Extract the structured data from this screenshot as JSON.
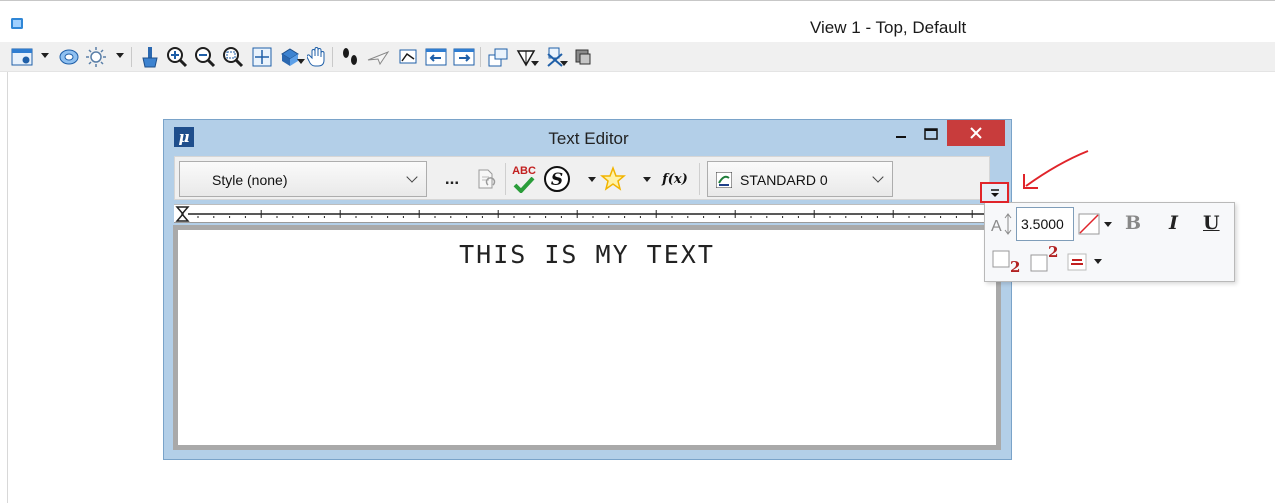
{
  "view": {
    "title": "View 1 - Top, Default",
    "toolbar_icons": [
      "view-attributes-icon",
      "display-style-icon",
      "brightness-icon",
      "update-view-icon",
      "zoom-in-icon",
      "zoom-out-icon",
      "window-area-icon",
      "fit-view-icon",
      "rotate-view-icon",
      "pan-view-icon",
      "walk-icon",
      "fly-icon",
      "change-view-perspective-icon",
      "previous-view-icon",
      "next-view-icon",
      "view-rotation-icon",
      "clip-volume-icon",
      "clip-mask-icon",
      "view-display-icon"
    ]
  },
  "text_editor": {
    "title": "Text Editor",
    "style_combo": "Style (none)",
    "ellipsis_label": "...",
    "spellcheck_label": "ABC",
    "fx_label": "f(x)",
    "font_combo": "STANDARD 0",
    "content_text": "THIS IS MY TEXT"
  },
  "format_panel": {
    "text_height": "3.5000",
    "bold_label": "B",
    "italic_label": "I",
    "underline_label": "U",
    "subscript_digit": "2",
    "superscript_digit": "2"
  },
  "colors": {
    "dialog_frame": "#b3cfe8",
    "close_button": "#c83c3c",
    "annotation": "#e0242a"
  }
}
